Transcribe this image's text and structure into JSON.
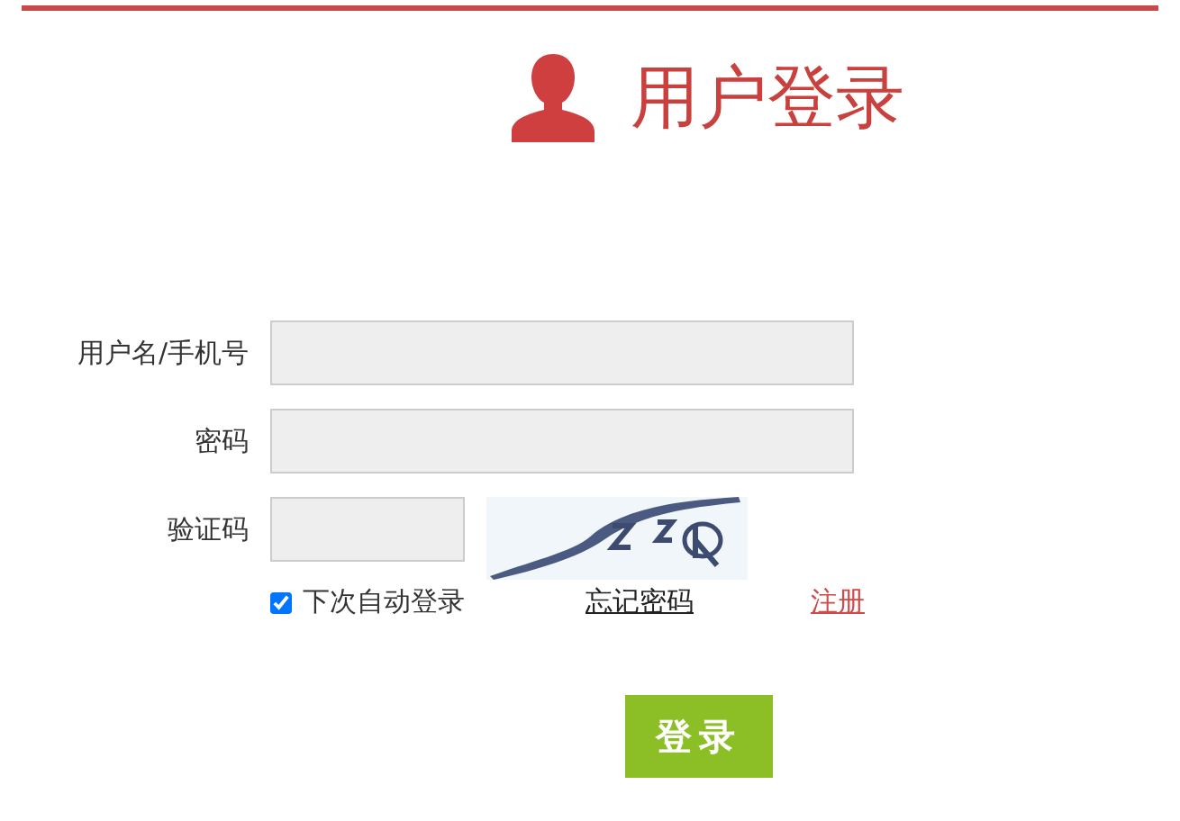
{
  "title": "用户登录",
  "fields": [
    {
      "label": "用户名/手机号",
      "kind": "wide"
    },
    {
      "label": "密码",
      "kind": "wide"
    },
    {
      "label": "验证码",
      "kind": "captcha"
    }
  ],
  "remember": {
    "label": "下次自动登录",
    "checked": true
  },
  "forgot_link": "忘记密码",
  "register_link": "注册",
  "submit": "登录"
}
